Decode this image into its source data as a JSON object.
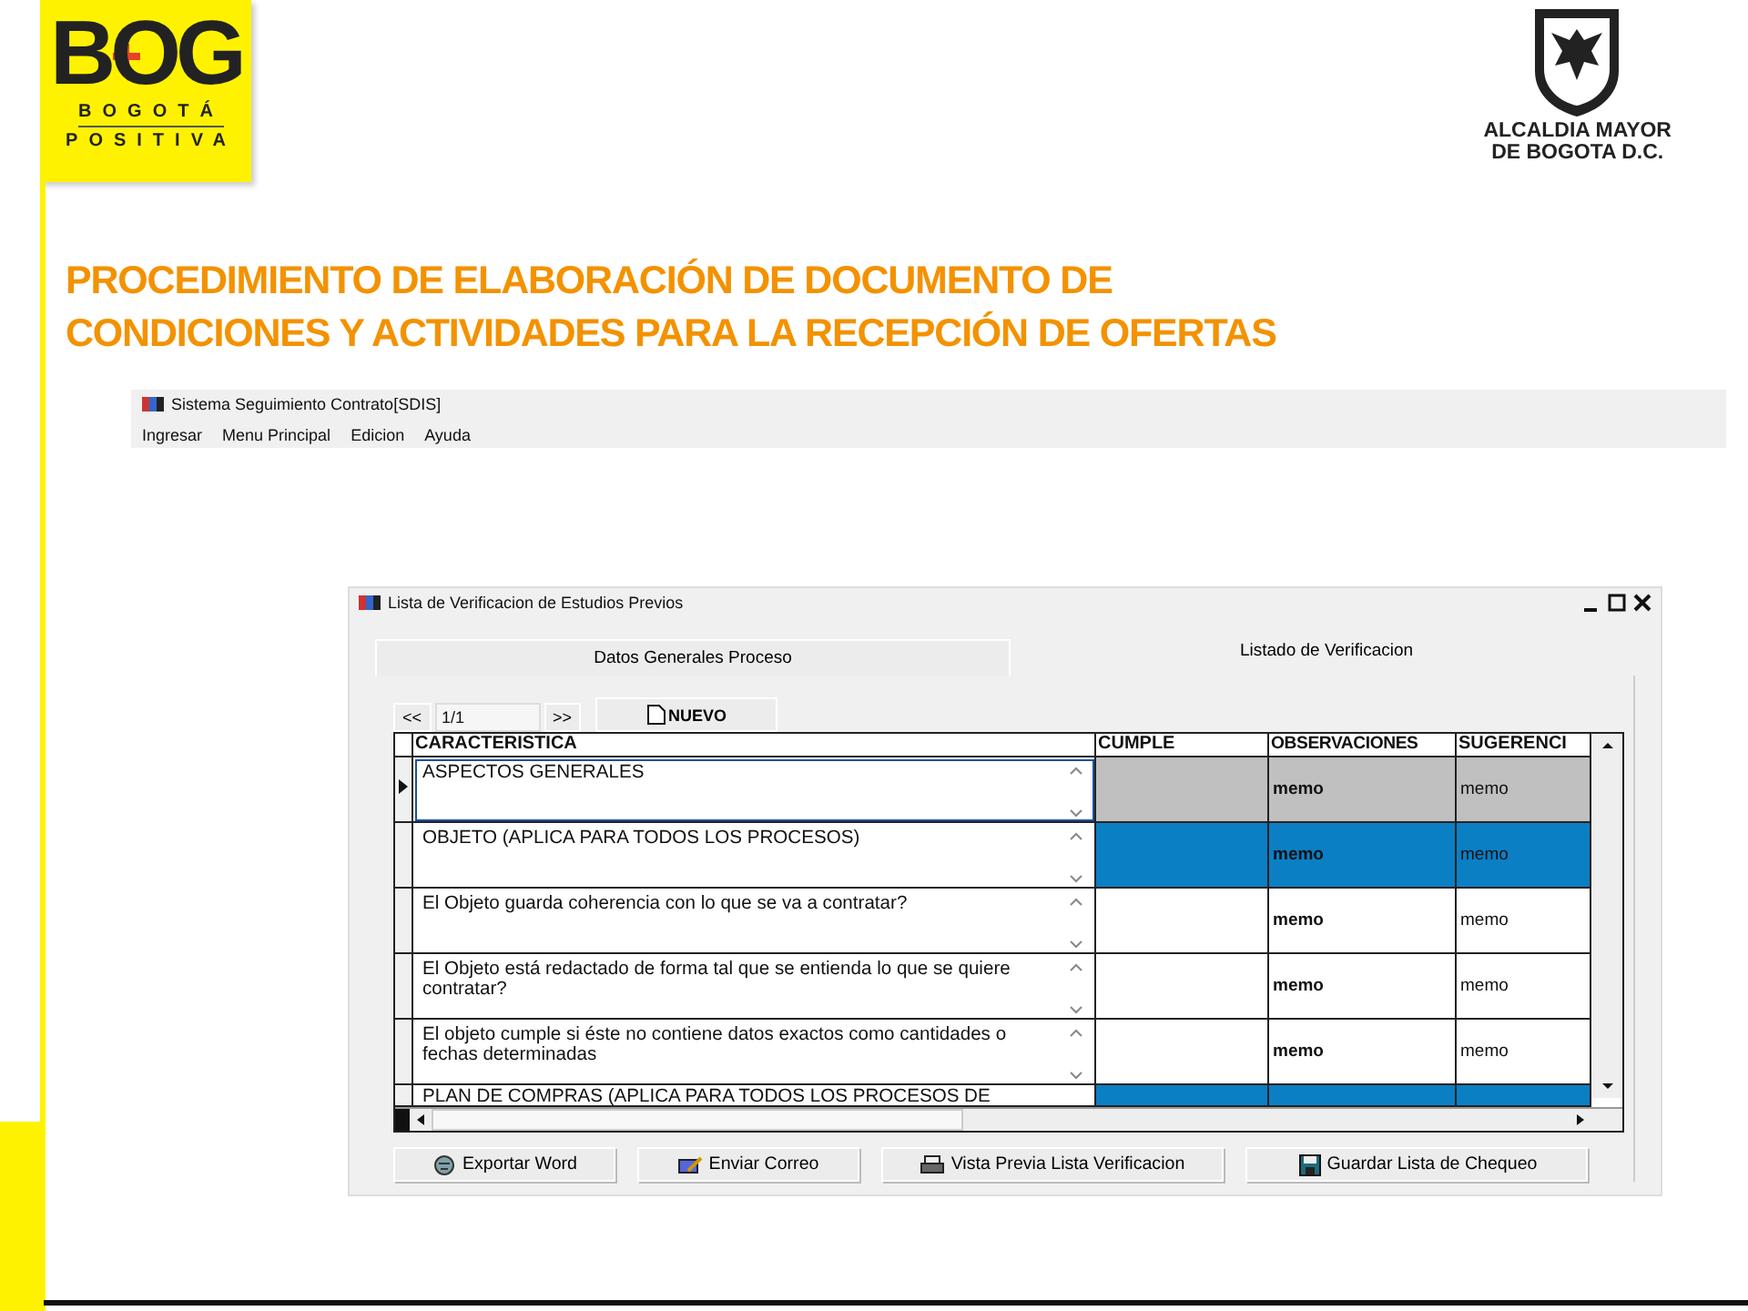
{
  "logo": {
    "wordmark": "BOG",
    "line_1": "BOGOTÁ",
    "line_2": "POSITIVA"
  },
  "crest": {
    "line_1": "ALCALDIA MAYOR",
    "line_2": "DE BOGOTA D.C."
  },
  "title_lines": [
    "PROCEDIMIENTO DE ELABORACIÓN DE DOCUMENTO DE",
    "CONDICIONES Y ACTIVIDADES PARA LA RECEPCIÓN DE OFERTAS"
  ],
  "app_window": {
    "title": "Sistema Seguimiento Contrato[SDIS]",
    "menu": [
      "Ingresar",
      "Menu Principal",
      "Edicion",
      "Ayuda"
    ]
  },
  "dialog": {
    "title": "Lista de Verificacion de Estudios Previos",
    "tabs": [
      {
        "label": "Datos Generales Proceso",
        "selected": false
      },
      {
        "label": "Listado de Verificacion",
        "selected": true
      }
    ],
    "pager": {
      "first": "<<",
      "page": "1/1",
      "next": ">>",
      "new_button": "NUEVO"
    },
    "table": {
      "columns": [
        "CARACTERISTICA",
        "CUMPLE",
        "OBSERVACIONES",
        "SUGERENCI"
      ],
      "rows": [
        {
          "text": "ASPECTOS GENERALES",
          "kind": "section",
          "selected": true,
          "observaciones": "memo",
          "sugerencias": "memo"
        },
        {
          "text": "OBJETO (APLICA PARA TODOS LOS PROCESOS)",
          "kind": "section",
          "selected": false,
          "observaciones": "memo",
          "sugerencias": "memo"
        },
        {
          "text": "El Objeto guarda coherencia con lo que se va a contratar?",
          "kind": "question",
          "selected": false,
          "observaciones": "memo",
          "sugerencias": "memo"
        },
        {
          "text": "El Objeto está redactado de forma tal que se entienda lo que se quiere contratar?",
          "kind": "question",
          "selected": false,
          "observaciones": "memo",
          "sugerencias": "memo"
        },
        {
          "text": "El objeto cumple si éste no contiene datos exactos como cantidades o fechas determinadas",
          "kind": "question",
          "selected": false,
          "observaciones": "memo",
          "sugerencias": "memo"
        },
        {
          "text": "PLAN DE COMPRAS (APLICA PARA TODOS LOS PROCESOS DE",
          "kind": "section",
          "selected": false
        }
      ]
    },
    "buttons": [
      {
        "label": "Exportar Word",
        "kind": "export"
      },
      {
        "label": "Enviar Correo",
        "kind": "mail"
      },
      {
        "label": "Vista Previa Lista Verificacion",
        "kind": "print"
      },
      {
        "label": "Guardar Lista de Chequeo",
        "kind": "save"
      }
    ]
  }
}
